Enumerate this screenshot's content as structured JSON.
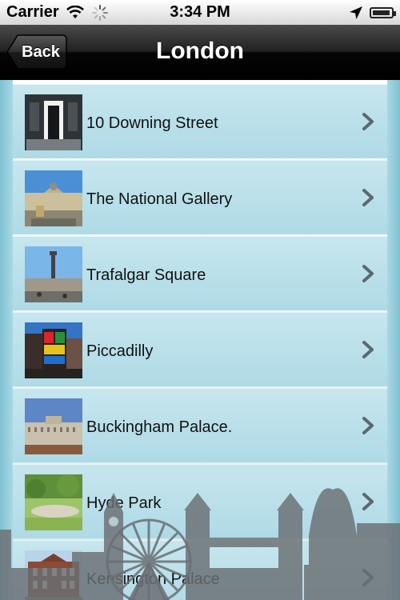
{
  "status": {
    "carrier": "Carrier",
    "time": "3:34 PM"
  },
  "nav": {
    "back_label": "Back",
    "title": "London"
  },
  "places": [
    {
      "label": "10 Downing Street"
    },
    {
      "label": "The National Gallery"
    },
    {
      "label": "Trafalgar Square"
    },
    {
      "label": "Piccadilly"
    },
    {
      "label": "Buckingham Palace."
    },
    {
      "label": "Hyde Park"
    },
    {
      "label": "Kensington Palace"
    }
  ]
}
